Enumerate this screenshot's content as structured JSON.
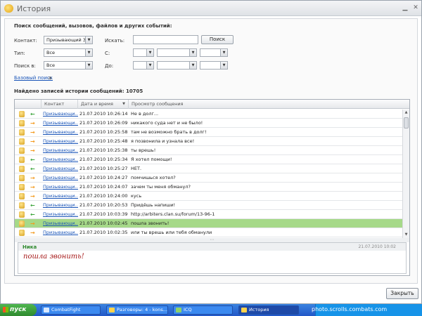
{
  "window": {
    "title": "История"
  },
  "search": {
    "title": "Поиск сообщений, вызовов, файлов и других событий:",
    "contact_label": "Контакт:",
    "contact_value": "Призывающий Зл",
    "find_label": "Искать:",
    "find_value": "",
    "search_button": "Поиск",
    "type_label": "Тип:",
    "type_value": "Все",
    "from_label": "С:",
    "search_in_label": "Поиск в:",
    "search_in_value": "Все",
    "to_label": "До:",
    "basic_search_link": "Базовый поиск",
    "basic_search_suffix": "а"
  },
  "results": {
    "found_text": "Найдено записей истории сообщений: 10705",
    "columns": [
      "Контакт",
      "Дата и время",
      "Просмотр сообщения"
    ],
    "rows": [
      {
        "dir": "in",
        "contact": "Призывающи...",
        "date": "21.07.2010 10:26:14",
        "message": "Не в долг..."
      },
      {
        "dir": "out",
        "contact": "Призывающи...",
        "date": "21.07.2010 10:26:09",
        "message": "никакого суда нет и не было!"
      },
      {
        "dir": "out",
        "contact": "Призывающи...",
        "date": "21.07.2010 10:25:58",
        "message": "там не возможно брать в долг!"
      },
      {
        "dir": "out",
        "contact": "Призывающи...",
        "date": "21.07.2010 10:25:48",
        "message": "я позвонила и узнала все!"
      },
      {
        "dir": "out",
        "contact": "Призывающи...",
        "date": "21.07.2010 10:25:38",
        "message": "ты врешь!"
      },
      {
        "dir": "in",
        "contact": "Призывающи...",
        "date": "21.07.2010 10:25:34",
        "message": "Я хотел помощи!"
      },
      {
        "dir": "in",
        "contact": "Призывающи...",
        "date": "21.07.2010 10:25:27",
        "message": "НЕТ."
      },
      {
        "dir": "out",
        "contact": "Призывающи...",
        "date": "21.07.2010 10:24:27",
        "message": "помчишься хотел?"
      },
      {
        "dir": "out",
        "contact": "Призывающи...",
        "date": "21.07.2010 10:24:07",
        "message": "зачем ты меня обманул?"
      },
      {
        "dir": "out",
        "contact": "Призывающи...",
        "date": "21.07.2010 10:24:00",
        "message": "кусь"
      },
      {
        "dir": "in",
        "contact": "Призывающи...",
        "date": "21.07.2010 10:20:53",
        "message": "Придёшь напиши!"
      },
      {
        "dir": "in",
        "contact": "Призывающи...",
        "date": "21.07.2010 10:03:39",
        "message": "http://arbiters.clan.su/forum/13-96-1"
      },
      {
        "dir": "out",
        "contact": "Призывающи...",
        "date": "21.07.2010 10:02:45",
        "message": "пошла звонить!",
        "selected": true
      },
      {
        "dir": "out",
        "contact": "Призывающи...",
        "date": "21.07.2010 10:02:35",
        "message": "или ты врешь или тебя обманули"
      }
    ]
  },
  "preview": {
    "name": "Ника",
    "date": "21.07.2010 10:02",
    "text": "пошла звонить!"
  },
  "close_button": "Закрыть",
  "taskbar": {
    "start": "пуск",
    "tasks": [
      "CombatFight",
      "Разговоры: 4 - kons...",
      "ICQ",
      "История"
    ]
  },
  "watermark": "photo.scrolls.combats.com"
}
